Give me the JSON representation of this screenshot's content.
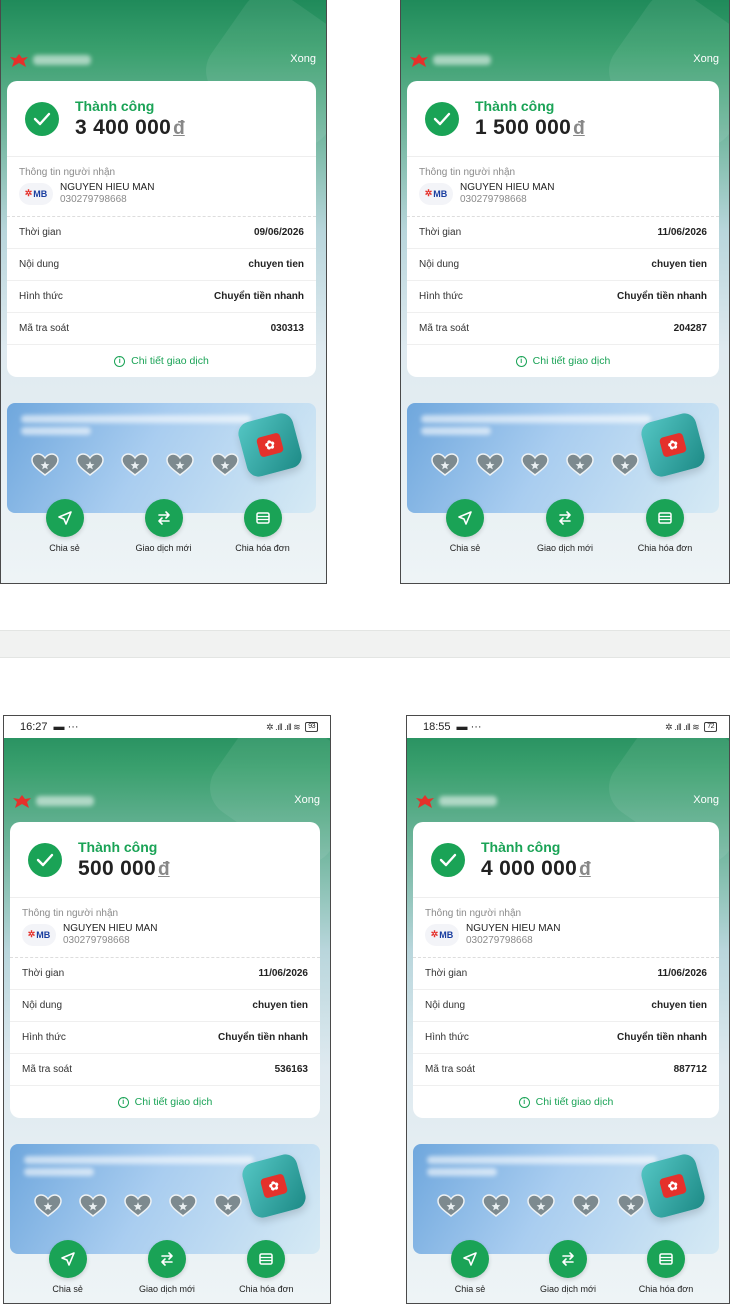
{
  "receipts": [
    {
      "status_bar": null,
      "done_label": "Xong",
      "status": "Thành công",
      "amount": "3 400 000",
      "currency": "đ",
      "recipient_title": "Thông tin người nhận",
      "bank_logo": "MB",
      "recipient_name": "NGUYEN HIEU MAN",
      "recipient_account": "030279798668",
      "rows": [
        {
          "label": "Thời gian",
          "value": "09/06/2026"
        },
        {
          "label": "Nội dung",
          "value": "chuyen tien"
        },
        {
          "label": "Hình thức",
          "value": "Chuyển tiền nhanh"
        },
        {
          "label": "Mã tra soát",
          "value": "030313"
        }
      ],
      "detail_link": "Chi tiết giao dịch",
      "actions": [
        {
          "label": "Chia sẻ",
          "icon": "send-icon"
        },
        {
          "label": "Giao dịch mới",
          "icon": "swap-icon"
        },
        {
          "label": "Chia hóa đơn",
          "icon": "receipt-icon"
        }
      ]
    },
    {
      "status_bar": null,
      "done_label": "Xong",
      "status": "Thành công",
      "amount": "1 500 000",
      "currency": "đ",
      "recipient_title": "Thông tin người nhận",
      "bank_logo": "MB",
      "recipient_name": "NGUYEN HIEU MAN",
      "recipient_account": "030279798668",
      "rows": [
        {
          "label": "Thời gian",
          "value": "11/06/2026"
        },
        {
          "label": "Nội dung",
          "value": "chuyen tien"
        },
        {
          "label": "Hình thức",
          "value": "Chuyển tiền nhanh"
        },
        {
          "label": "Mã tra soát",
          "value": "204287"
        }
      ],
      "detail_link": "Chi tiết giao dịch",
      "actions": [
        {
          "label": "Chia sẻ",
          "icon": "send-icon"
        },
        {
          "label": "Giao dịch mới",
          "icon": "swap-icon"
        },
        {
          "label": "Chia hóa đơn",
          "icon": "receipt-icon"
        }
      ]
    },
    {
      "status_bar": {
        "time": "16:27",
        "battery": "93"
      },
      "done_label": "Xong",
      "status": "Thành công",
      "amount": "500 000",
      "currency": "đ",
      "recipient_title": "Thông tin người nhận",
      "bank_logo": "MB",
      "recipient_name": "NGUYEN HIEU MAN",
      "recipient_account": "030279798668",
      "rows": [
        {
          "label": "Thời gian",
          "value": "11/06/2026"
        },
        {
          "label": "Nội dung",
          "value": "chuyen tien"
        },
        {
          "label": "Hình thức",
          "value": "Chuyển tiền nhanh"
        },
        {
          "label": "Mã tra soát",
          "value": "536163"
        }
      ],
      "detail_link": "Chi tiết giao dịch",
      "actions": [
        {
          "label": "Chia sẻ",
          "icon": "send-icon"
        },
        {
          "label": "Giao dịch mới",
          "icon": "swap-icon"
        },
        {
          "label": "Chia hóa đơn",
          "icon": "receipt-icon"
        }
      ]
    },
    {
      "status_bar": {
        "time": "18:55",
        "battery": "72"
      },
      "done_label": "Xong",
      "status": "Thành công",
      "amount": "4 000 000",
      "currency": "đ",
      "recipient_title": "Thông tin người nhận",
      "bank_logo": "MB",
      "recipient_name": "NGUYEN HIEU MAN",
      "recipient_account": "030279798668",
      "rows": [
        {
          "label": "Thời gian",
          "value": "11/06/2026"
        },
        {
          "label": "Nội dung",
          "value": "chuyen tien"
        },
        {
          "label": "Hình thức",
          "value": "Chuyển tiền nhanh"
        },
        {
          "label": "Mã tra soát",
          "value": "887712"
        }
      ],
      "detail_link": "Chi tiết giao dịch",
      "actions": [
        {
          "label": "Chia sẻ",
          "icon": "send-icon"
        },
        {
          "label": "Giao dịch mới",
          "icon": "swap-icon"
        },
        {
          "label": "Chia hóa đơn",
          "icon": "receipt-icon"
        }
      ]
    }
  ],
  "colors": {
    "brand_green": "#1aa356",
    "header_green": "#1f8a5a",
    "logo_red": "#e5312b"
  }
}
